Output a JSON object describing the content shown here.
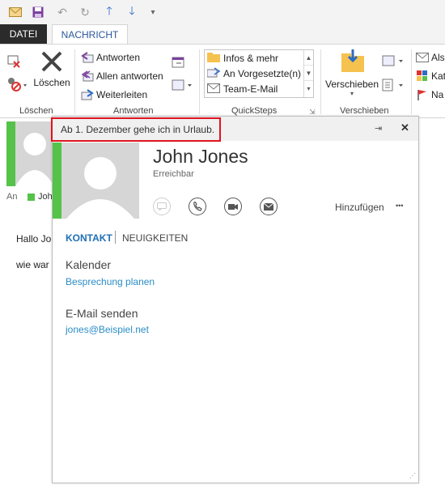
{
  "ribbon": {
    "tabs": {
      "datei": "DATEI",
      "nachricht": "NACHRICHT"
    },
    "loeschen": {
      "button": "Löschen",
      "group": "Löschen"
    },
    "antworten": {
      "reply": "Antworten",
      "reply_all": "Allen antworten",
      "forward": "Weiterleiten",
      "group": "Antworten"
    },
    "quicksteps": {
      "items": [
        "Infos & mehr",
        "An Vorgesetzte(n)",
        "Team-E-Mail"
      ],
      "group": "QuickSteps"
    },
    "verschieben": {
      "button": "Verschieben",
      "group": "Verschieben"
    },
    "right_items": [
      "Als",
      "Kat",
      "Na"
    ]
  },
  "message": {
    "to_label": "An",
    "to_name": "John",
    "greeting": "Hallo Jo",
    "line2": "wie war"
  },
  "card": {
    "oof_message": "Ab 1. Dezember gehe ich in Urlaub.",
    "name": "John Jones",
    "status": "Erreichbar",
    "add_label": "Hinzufügen",
    "more": "•••",
    "tabs": {
      "contact": "KONTAKT",
      "news": "NEUIGKEITEN"
    },
    "calendar": {
      "heading": "Kalender",
      "link": "Besprechung planen"
    },
    "email": {
      "heading": "E-Mail senden",
      "address": "jones@Beispiel.net"
    }
  },
  "colors": {
    "accent": "#2b579a",
    "presence": "#55c24a",
    "highlight": "#e0141e",
    "link": "#2a8dc6"
  }
}
